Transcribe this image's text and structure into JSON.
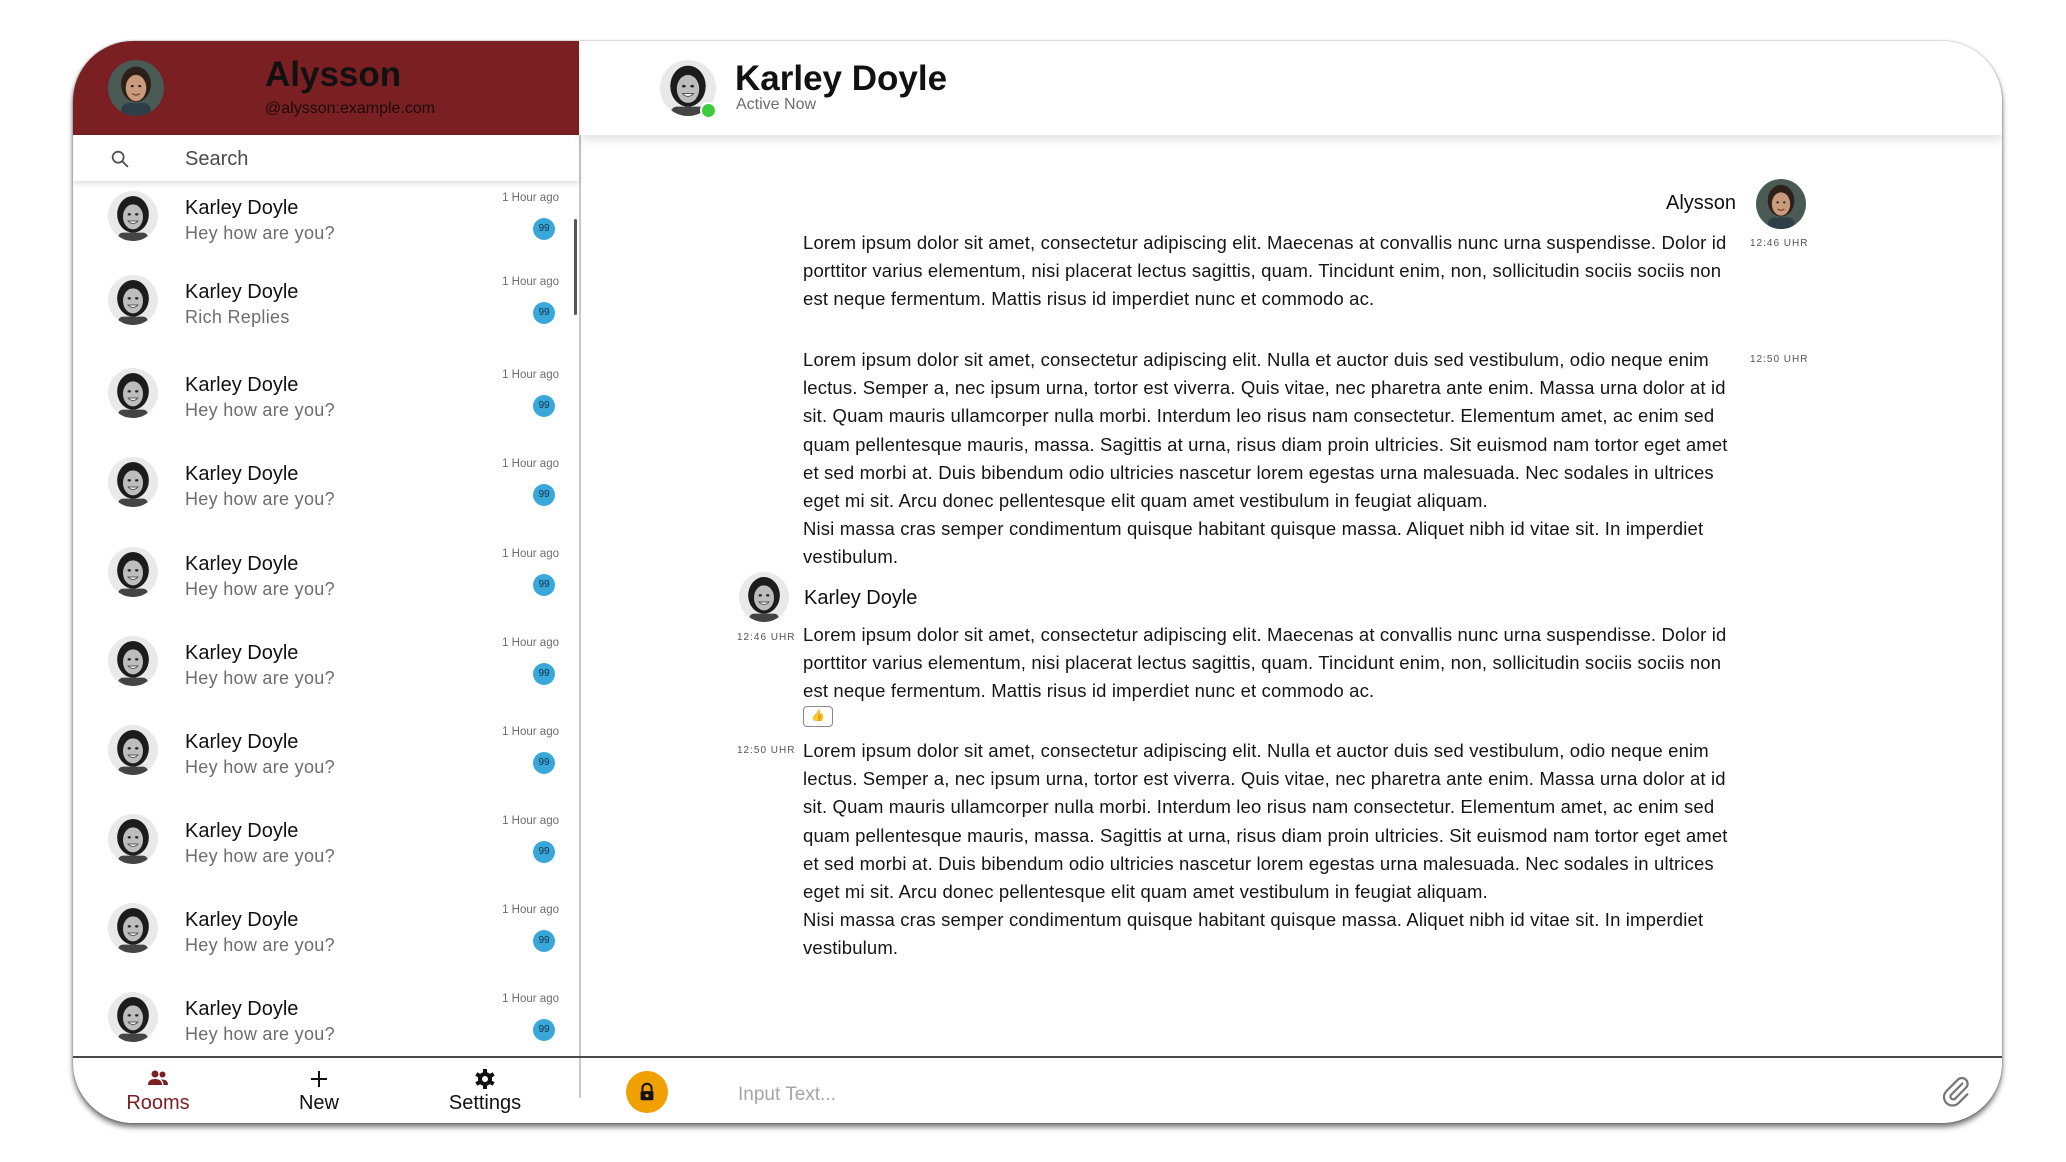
{
  "user": {
    "name": "Alysson",
    "handle": "@alysson:example.com"
  },
  "search": {
    "placeholder": "Search"
  },
  "rooms": [
    {
      "name": "Karley Doyle",
      "preview": "Hey how are you?",
      "time": "1 Hour ago",
      "unread": "99"
    },
    {
      "name": "Karley Doyle",
      "preview": "Rich Replies",
      "time": "1 Hour ago",
      "unread": "99"
    },
    {
      "name": "Karley Doyle",
      "preview": "Hey how are you?",
      "time": "1 Hour ago",
      "unread": "99"
    },
    {
      "name": "Karley Doyle",
      "preview": "Hey how are you?",
      "time": "1 Hour ago",
      "unread": "99"
    },
    {
      "name": "Karley Doyle",
      "preview": "Hey how are you?",
      "time": "1 Hour ago",
      "unread": "99"
    },
    {
      "name": "Karley Doyle",
      "preview": "Hey how are you?",
      "time": "1 Hour ago",
      "unread": "99"
    },
    {
      "name": "Karley Doyle",
      "preview": "Hey how are you?",
      "time": "1 Hour ago",
      "unread": "99"
    },
    {
      "name": "Karley Doyle",
      "preview": "Hey how are you?",
      "time": "1 Hour ago",
      "unread": "99"
    },
    {
      "name": "Karley Doyle",
      "preview": "Hey how are you?",
      "time": "1 Hour ago",
      "unread": "99"
    },
    {
      "name": "Karley Doyle",
      "preview": "Hey how are you?",
      "time": "1 Hour ago",
      "unread": "99"
    }
  ],
  "nav": {
    "rooms": "Rooms",
    "new": "New",
    "settings": "Settings"
  },
  "chat": {
    "peer_name": "Karley Doyle",
    "peer_status": "Active Now",
    "messages": [
      {
        "author": "Alysson",
        "time": "12:46 UHR",
        "text": "Lorem ipsum dolor sit amet, consectetur adipiscing elit. Maecenas at convallis nunc urna suspendisse. Dolor id porttitor varius elementum, nisi placerat lectus sagittis, quam. Tincidunt enim, non, sollicitudin sociis sociis non est neque fermentum. Mattis risus id imperdiet nunc et commodo ac."
      },
      {
        "author": "",
        "time": "12:50 UHR",
        "text": "Lorem ipsum dolor sit amet, consectetur adipiscing elit. Nulla et auctor duis sed vestibulum, odio neque enim lectus. Semper a, nec ipsum urna, tortor est viverra. Quis vitae, nec pharetra ante enim. Massa urna dolor at id sit. Quam mauris ullamcorper nulla morbi. Interdum leo risus nam consectetur. Elementum amet, ac enim sed quam pellentesque mauris, massa. Sagittis at urna, risus diam proin ultricies. Sit euismod nam tortor eget amet et sed morbi at. Duis bibendum odio ultricies nascetur lorem egestas urna malesuada. Nec sodales in ultrices eget mi sit. Arcu donec pellentesque elit quam amet vestibulum in feugiat aliquam.\nNisi massa cras semper condimentum quisque habitant quisque massa. Aliquet nibh id vitae sit. In imperdiet vestibulum."
      },
      {
        "author": "Karley Doyle",
        "time": "12:46 UHR",
        "text": "Lorem ipsum dolor sit amet, consectetur adipiscing elit. Maecenas at convallis nunc urna suspendisse. Dolor id porttitor varius elementum, nisi placerat lectus sagittis, quam. Tincidunt enim, non, sollicitudin sociis sociis non est neque fermentum. Mattis risus id imperdiet nunc et commodo ac.",
        "reaction": "👍"
      },
      {
        "author": "",
        "time": "12:50 UHR",
        "text": "Lorem ipsum dolor sit amet, consectetur adipiscing elit. Nulla et auctor duis sed vestibulum, odio neque enim lectus. Semper a, nec ipsum urna, tortor est viverra. Quis vitae, nec pharetra ante enim. Massa urna dolor at id sit. Quam mauris ullamcorper nulla morbi. Interdum leo risus nam consectetur. Elementum amet, ac enim sed quam pellentesque mauris, massa. Sagittis at urna, risus diam proin ultricies. Sit euismod nam tortor eget amet et sed morbi at. Duis bibendum odio ultricies nascetur lorem egestas urna malesuada. Nec sodales in ultrices eget mi sit. Arcu donec pellentesque elit quam amet vestibulum in feugiat aliquam.\nNisi massa cras semper condimentum quisque habitant quisque massa. Aliquet nibh id vitae sit. In imperdiet vestibulum."
      }
    ]
  },
  "composer": {
    "placeholder": "Input Text..."
  },
  "colors": {
    "header": "#7a2022",
    "accent": "#7a2022",
    "badge": "#3aa7da",
    "lock": "#f0a000",
    "online": "#3ecc3e"
  },
  "icons": {
    "search": "search-icon",
    "rooms": "people-icon",
    "new": "plus-icon",
    "settings": "gear-icon",
    "lock": "lock-icon",
    "attach": "paperclip-icon"
  }
}
